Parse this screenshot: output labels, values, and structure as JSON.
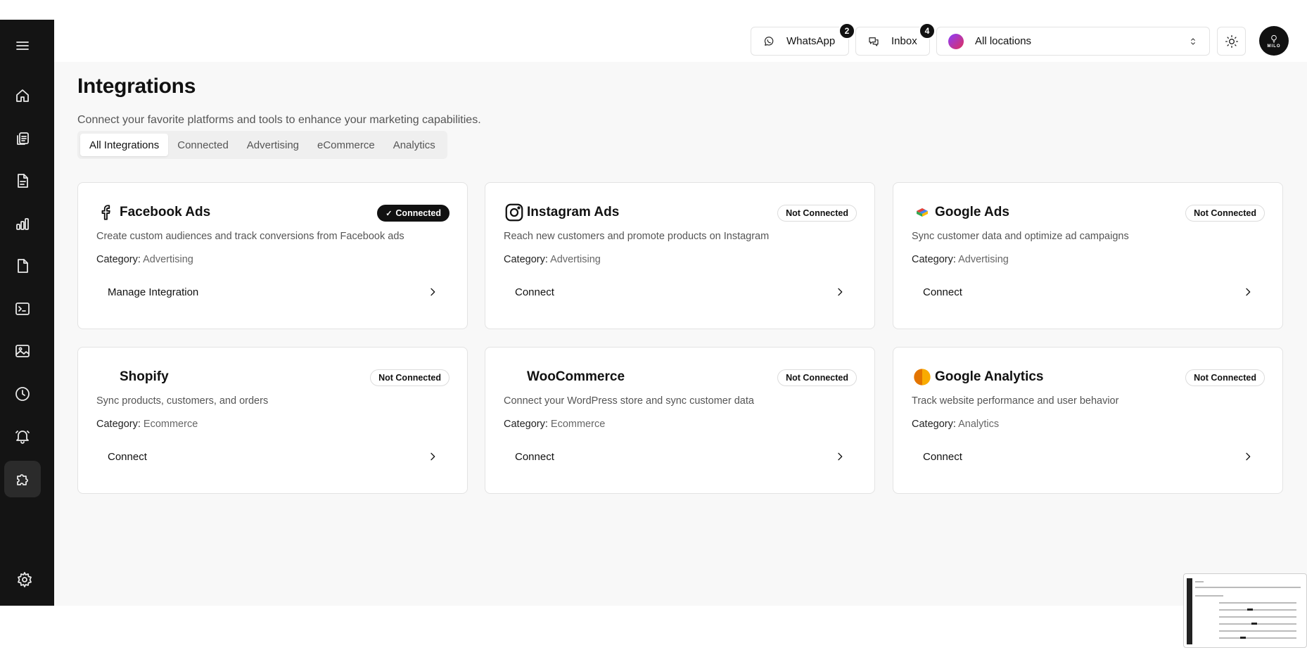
{
  "header": {
    "whatsapp": {
      "label": "WhatsApp",
      "count": "2"
    },
    "inbox": {
      "label": "Inbox",
      "count": "4"
    },
    "location_select": {
      "value": "All locations"
    },
    "avatar_text": "MILO"
  },
  "sidebar": {
    "items": [
      {
        "icon": "menu-icon"
      },
      {
        "icon": "home-icon"
      },
      {
        "icon": "copy-icon"
      },
      {
        "icon": "document-icon"
      },
      {
        "icon": "bar-chart-icon"
      },
      {
        "icon": "file-icon"
      },
      {
        "icon": "terminal-icon"
      },
      {
        "icon": "image-icon"
      },
      {
        "icon": "clock-icon"
      },
      {
        "icon": "bell-icon"
      },
      {
        "icon": "puzzle-icon",
        "active": true
      },
      {
        "icon": "settings-icon"
      }
    ]
  },
  "page": {
    "title": "Integrations",
    "subtitle": "Connect your favorite platforms and tools to enhance your marketing capabilities."
  },
  "tabs": [
    "All Integrations",
    "Connected",
    "Advertising",
    "eCommerce",
    "Analytics"
  ],
  "active_tab": "All Integrations",
  "category_label": "Category:",
  "cards": [
    {
      "name": "Facebook Ads",
      "logo": "facebook-logo",
      "status": "Connected",
      "connected": true,
      "description": "Create custom audiences and track conversions from Facebook ads",
      "category": "Advertising",
      "action": "Manage Integration"
    },
    {
      "name": "Instagram Ads",
      "logo": "instagram-logo",
      "status": "Not Connected",
      "connected": false,
      "description": "Reach new customers and promote products on Instagram",
      "category": "Advertising",
      "action": "Connect"
    },
    {
      "name": "Google Ads",
      "logo": "google-ads-logo",
      "status": "Not Connected",
      "connected": false,
      "description": "Sync customer data and optimize ad campaigns",
      "category": "Advertising",
      "action": "Connect"
    },
    {
      "name": "Shopify",
      "logo": "shopify-logo",
      "status": "Not Connected",
      "connected": false,
      "description": "Sync products, customers, and orders",
      "category": "Ecommerce",
      "action": "Connect"
    },
    {
      "name": "WooCommerce",
      "logo": "woocommerce-logo",
      "status": "Not Connected",
      "connected": false,
      "description": "Connect your WordPress store and sync customer data",
      "category": "Ecommerce",
      "action": "Connect"
    },
    {
      "name": "Google Analytics",
      "logo": "google-analytics-logo",
      "status": "Not Connected",
      "connected": false,
      "description": "Track website performance and user behavior",
      "category": "Analytics",
      "action": "Connect"
    }
  ],
  "colors": {
    "sidebar_bg": "#141414",
    "page_bg": "#f8f8f8",
    "connected_badge": "#111111"
  }
}
